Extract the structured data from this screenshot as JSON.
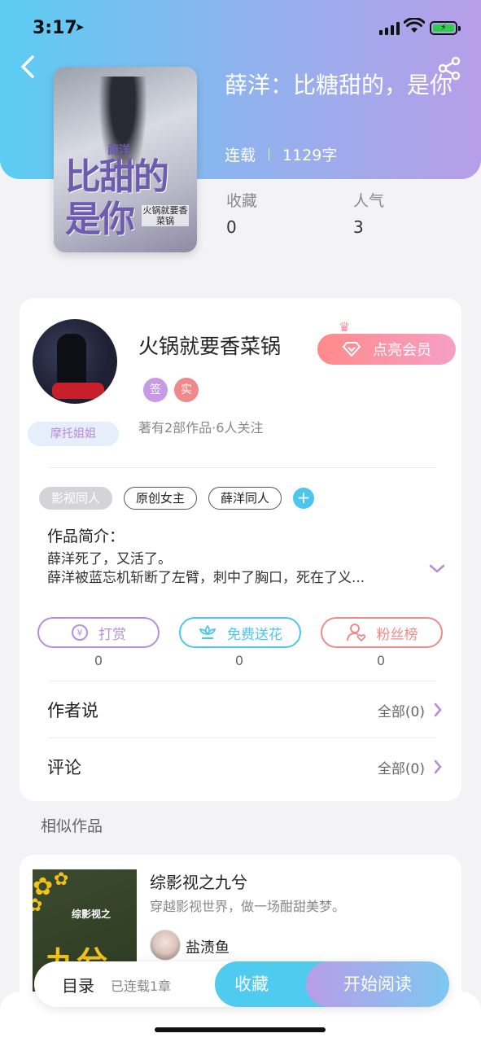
{
  "status_bar": {
    "time": "3:17"
  },
  "book": {
    "title": "薛洋：比糖甜的，是你",
    "status": "连载",
    "word_count": "1129字",
    "cover": {
      "title": "比甜的是你",
      "subtitle": "薛洋",
      "author_tag": "火锅就要香菜锅"
    },
    "stats": [
      {
        "label": "收藏",
        "value": "0"
      },
      {
        "label": "人气",
        "value": "3"
      }
    ]
  },
  "author": {
    "name": "火锅就要香菜锅",
    "badges": [
      {
        "text": "签",
        "color": "#c79ae6"
      },
      {
        "text": "实",
        "color": "#f08a8a"
      }
    ],
    "fan_badge": "摩托姐姐",
    "meta": "著有2部作品·6人关注",
    "vip_button": "点亮会员"
  },
  "tags": [
    {
      "label": "影视同人",
      "filled": true
    },
    {
      "label": "原创女主",
      "filled": false
    },
    {
      "label": "薛洋同人",
      "filled": false
    }
  ],
  "intro": {
    "label": "作品简介：",
    "lines": [
      "薛洋死了，又活了。",
      "薛洋被蓝忘机斩断了左臂，刺中了胸口，死在了义..."
    ]
  },
  "actions": [
    {
      "label": "打赏",
      "count": "0",
      "color": "#b48fe0",
      "icon": "coin-icon"
    },
    {
      "label": "免费送花",
      "count": "0",
      "color": "#4cc6ee",
      "icon": "flower-icon"
    },
    {
      "label": "粉丝榜",
      "count": "0",
      "color": "#f08a8a",
      "icon": "user-heart-icon"
    }
  ],
  "rows": [
    {
      "label": "作者说",
      "right": "全部(0)"
    },
    {
      "label": "评论",
      "right": "全部(0)"
    }
  ],
  "similar": {
    "title": "相似作品",
    "items": [
      {
        "name": "综影视之九兮",
        "desc": "穿越影视世界，做一场酣甜美梦。",
        "author": "盐渍鱼",
        "cover": {
          "label": "综影视之",
          "big": "九兮"
        }
      }
    ]
  },
  "bottom": {
    "toc_label": "目录",
    "toc_status": "已连载1章",
    "fav_label": "收藏",
    "read_label": "开始阅读"
  },
  "colors": {
    "accent_blue": "#4ecbef",
    "accent_purple": "#b79ee8",
    "accent_pink": "#f08a8a"
  }
}
